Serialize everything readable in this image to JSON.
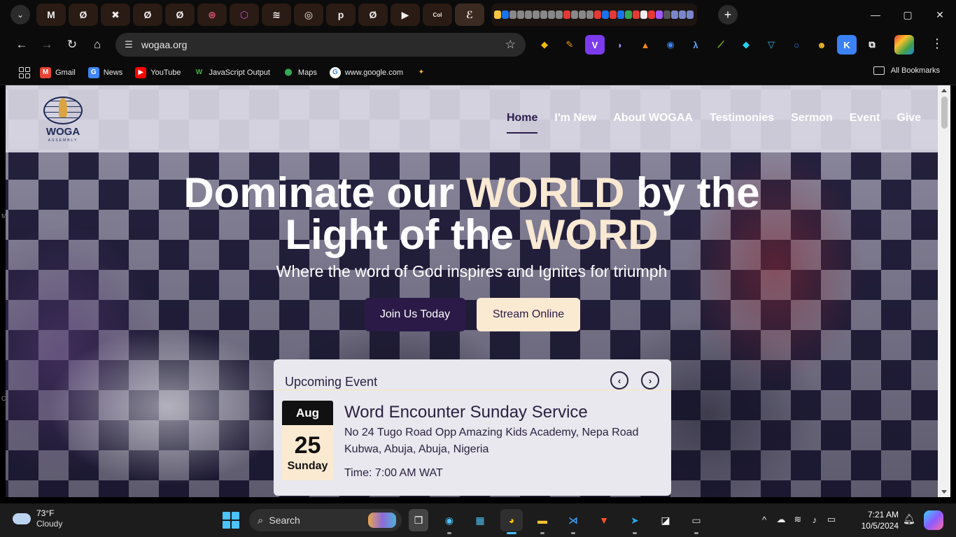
{
  "browser": {
    "pinned_tabs": [
      {
        "name": "gmail-tab",
        "glyph": "M"
      },
      {
        "name": "tab-2",
        "glyph": "Ø"
      },
      {
        "name": "tab-3",
        "glyph": "✖"
      },
      {
        "name": "tab-4",
        "glyph": "Ø"
      },
      {
        "name": "tab-5",
        "glyph": "Ø"
      },
      {
        "name": "tab-6",
        "glyph": "⊛"
      },
      {
        "name": "tab-7",
        "glyph": "⬡"
      },
      {
        "name": "tab-8",
        "glyph": "≋"
      },
      {
        "name": "tab-9",
        "glyph": "◎"
      },
      {
        "name": "tab-10",
        "glyph": "p"
      },
      {
        "name": "tab-11",
        "glyph": "Ø"
      },
      {
        "name": "tab-12",
        "glyph": "▶"
      },
      {
        "name": "tab-13",
        "glyph": "Col"
      },
      {
        "name": "tab-14",
        "glyph": "ℰ"
      }
    ],
    "url": "wogaa.org",
    "bookmarks": [
      {
        "label": "Gmail",
        "icon": "gmail-icon",
        "color": "#ea4335",
        "glyph": "M"
      },
      {
        "label": "News",
        "icon": "news-icon",
        "color": "#4285f4",
        "glyph": "G"
      },
      {
        "label": "YouTube",
        "icon": "youtube-icon",
        "color": "#ff0000",
        "glyph": "▶"
      },
      {
        "label": "JavaScript Output",
        "icon": "w-icon",
        "color": "#2e7d32",
        "glyph": "W"
      },
      {
        "label": "Maps",
        "icon": "maps-icon",
        "color": "#34a853",
        "glyph": "⬤"
      },
      {
        "label": "www.google.com",
        "icon": "google-icon",
        "color": "#4285f4",
        "glyph": "G"
      }
    ],
    "all_bookmarks": "All Bookmarks"
  },
  "site": {
    "nav": [
      "Home",
      "I'm New",
      "About WOGAA",
      "Testimonies",
      "Sermon",
      "Event",
      "Give"
    ],
    "logo_text": "WOGA",
    "logo_sub": "ASSEMBLY",
    "hero": {
      "line1_a": "Dominate our ",
      "line1_b": "WORLD",
      "line1_c": " by the",
      "line2_a": "Light of the ",
      "line2_b": "WORD",
      "subtitle": "Where the word of God inspires and Ignites for triumph",
      "join_label": "Join Us Today",
      "stream_label": "Stream Online"
    },
    "event": {
      "heading": "Upcoming Event",
      "month": "Aug",
      "day": "25",
      "weekday": "Sunday",
      "title": "Word Encounter Sunday Service",
      "address": "No 24 Tugo Road Opp Amazing Kids Academy, Nepa Road Kubwa, Abuja, Abuja, Nigeria",
      "time": "Time: 7:00 AM WAT"
    }
  },
  "taskbar": {
    "temperature": "73°F",
    "condition": "Cloudy",
    "search": "Search",
    "time": "7:21 AM",
    "date": "10/5/2024"
  },
  "colors": {
    "brand_dark": "#2b1a47",
    "brand_cream": "#fbead2",
    "accent_text": "#f9e9d2"
  }
}
